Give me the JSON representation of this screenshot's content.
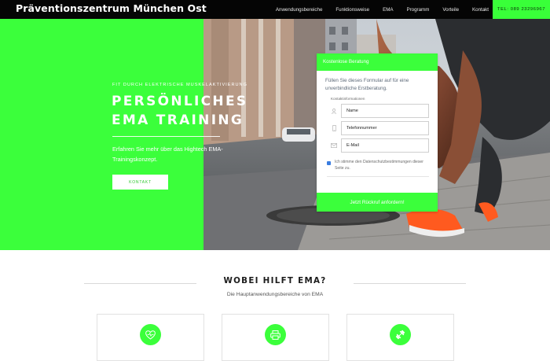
{
  "brand": "Präventionszentrum München Ost",
  "nav": {
    "items": [
      "Anwendungsbereiche",
      "Funktionsweise",
      "EMA",
      "Programm",
      "Vorteile",
      "Kontakt"
    ],
    "tel": "TEL: 089 23296967"
  },
  "hero": {
    "kicker": "FIT DURCH ELEKTRISCHE MUSKELAKTIVIERUNG",
    "title_line1": "PERSÖNLICHES",
    "title_line2": "EMA TRAINING",
    "text": "Erfahren Sie mehr über das Hightech EMA-Trainingskonzept.",
    "button": "KONTAKT"
  },
  "form": {
    "header": "Kostenlose Beratung",
    "intro": "Füllen Sie dieses Formular auf für eine unverbindliche Erstberatung.",
    "section_label": "Kontaktinformationen",
    "fields": [
      {
        "icon": "user-icon",
        "placeholder": "Name"
      },
      {
        "icon": "phone-icon",
        "placeholder": "Telefonnummer"
      },
      {
        "icon": "email-icon",
        "placeholder": "E-Mail"
      }
    ],
    "consent": "Ich stimme den Datenschutzbestimmungen dieser Seite zu.",
    "consent_checked": true,
    "submit": "Jetzt Rückruf anfordern!"
  },
  "section": {
    "title": "WOBEI HILFT EMA?",
    "subtitle": "Die Hauptanwendungsbereiche von EMA",
    "card_icons": [
      "heart-icon",
      "printer-icon",
      "dumbbell-icon"
    ]
  },
  "colors": {
    "accent": "#3bff3b",
    "nav_bg": "#050505",
    "checkbox": "#3a7de0"
  }
}
